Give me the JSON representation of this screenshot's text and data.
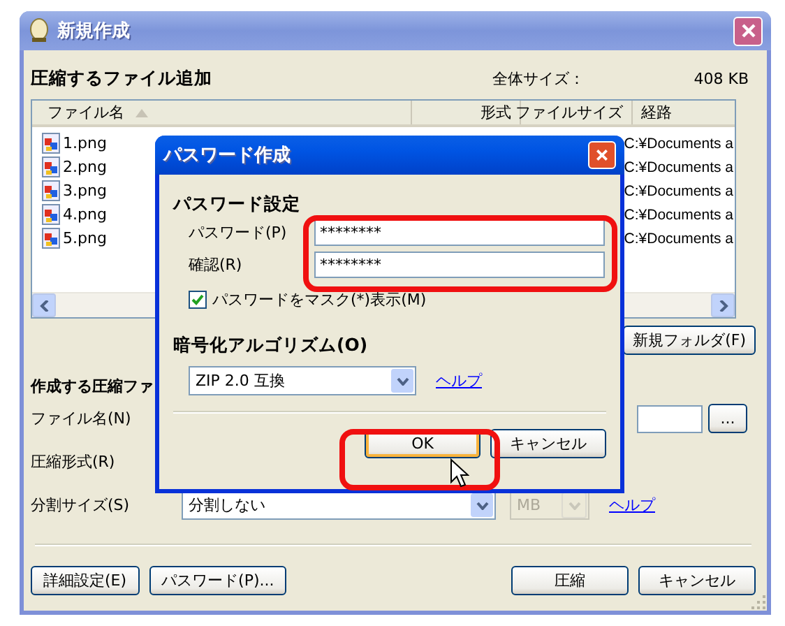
{
  "window": {
    "title": "新規作成"
  },
  "add_section": {
    "heading": "圧縮するファイル追加",
    "total_label": "全体サイズ：",
    "total_value": "408 KB"
  },
  "file_list": {
    "columns": [
      {
        "label": "ファイル名",
        "sorted": true
      },
      {
        "label": "形式",
        "sorted": false
      },
      {
        "label": "ファイルサイズ",
        "sorted": false
      },
      {
        "label": "経路",
        "sorted": false
      }
    ],
    "rows": [
      {
        "name": "1.png",
        "path": "C:¥Documents a"
      },
      {
        "name": "2.png",
        "path": "C:¥Documents a"
      },
      {
        "name": "3.png",
        "path": "C:¥Documents a"
      },
      {
        "name": "4.png",
        "path": "C:¥Documents a"
      },
      {
        "name": "5.png",
        "path": "C:¥Documents a"
      }
    ]
  },
  "new_folder_button": "新規フォルダ(F)",
  "create_section": {
    "heading": "作成する圧縮ファ",
    "file_name_label": "ファイル名(N)",
    "browse_button": "...",
    "format_label": "圧縮形式(R)",
    "split_label": "分割サイズ(S)",
    "split_value": "分割しない",
    "unit_value": "MB",
    "unit_disabled": true,
    "help_link": "ヘルプ"
  },
  "bottom_left_buttons": [
    "詳細設定(E)",
    "パスワード(P)..."
  ],
  "bottom_right_buttons": [
    "圧縮",
    "キャンセル"
  ],
  "dialog": {
    "title": "パスワード作成",
    "section": "パスワード設定",
    "password_label": "パスワード(P)",
    "password_value": "********",
    "confirm_label": "確認(R)",
    "confirm_value": "********",
    "mask": {
      "label": "パスワードをマスク(*)表示(M)",
      "checked": true
    },
    "algorithm_heading": "暗号化アルゴリズム(O)",
    "algorithm_value": "ZIP 2.0 互換",
    "help_link": "ヘルプ",
    "buttons": [
      {
        "label": "OK",
        "focused": true
      },
      {
        "label": "キャンセル",
        "focused": false
      }
    ]
  }
}
